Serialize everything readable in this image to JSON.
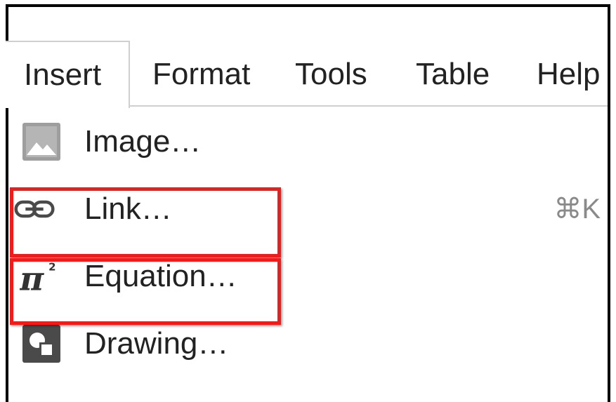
{
  "menubar": {
    "tabs": [
      {
        "label": "Insert",
        "active": true
      },
      {
        "label": "Format",
        "active": false
      },
      {
        "label": "Tools",
        "active": false
      },
      {
        "label": "Table",
        "active": false
      },
      {
        "label": "Help",
        "active": false
      }
    ]
  },
  "dropdown": {
    "items": [
      {
        "label": "Image…",
        "icon": "image-icon",
        "shortcut": ""
      },
      {
        "label": "Link…",
        "icon": "link-icon",
        "shortcut": "⌘K"
      },
      {
        "label": "Equation…",
        "icon": "pi-squared-icon",
        "shortcut": ""
      },
      {
        "label": "Drawing…",
        "icon": "drawing-icon",
        "shortcut": ""
      }
    ]
  },
  "colors": {
    "highlight": "#ef1c1c",
    "text": "#222222",
    "icon_gray": "#9e9e9e",
    "icon_dark": "#4a4a4a",
    "shortcut": "#8a8a8a"
  }
}
